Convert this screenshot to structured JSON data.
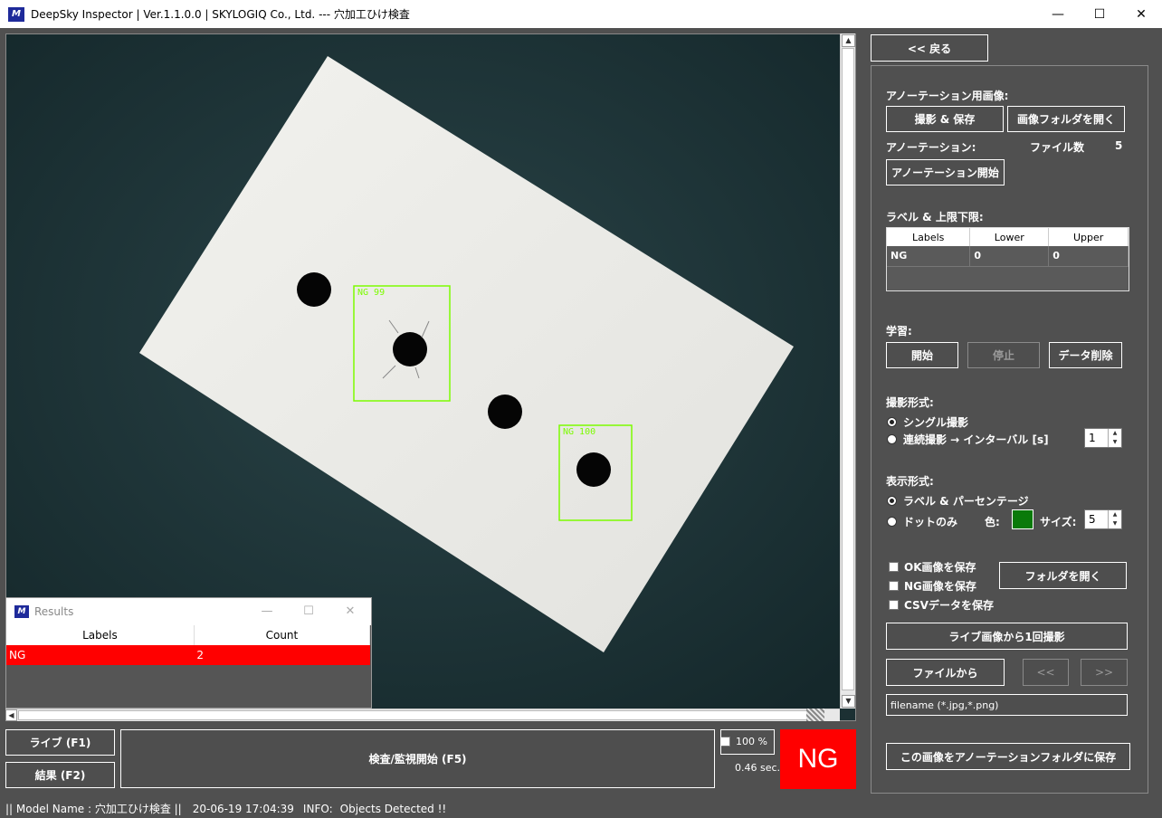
{
  "window": {
    "title": "DeepSky Inspector | Ver.1.1.0.0 | SKYLOGIQ Co., Ltd. --- 穴加工ひけ検査",
    "icon": "app-logo-icon"
  },
  "viewer": {
    "detections": [
      {
        "label": "NG 99"
      },
      {
        "label": "NG 100"
      }
    ]
  },
  "results_window": {
    "title": "Results",
    "columns": [
      "Labels",
      "Count"
    ],
    "rows": [
      {
        "label": "NG",
        "count": "2"
      }
    ]
  },
  "bottom": {
    "live_button": "ライブ (F1)",
    "result_button": "結果 (F2)",
    "inspect_button": "検査/監視開始 (F5)",
    "zoom_label": "100 %",
    "time_label": "0.46 sec.",
    "judgement": "NG",
    "judgement_color": "#ff0000"
  },
  "right": {
    "back_button": "<< 戻る",
    "annotation_image_label": "アノーテーション用画像:",
    "capture_save_button": "撮影 & 保存",
    "open_image_folder_button": "画像フォルダを開く",
    "annotation_label": "アノーテーション:",
    "file_count_label": "ファイル数",
    "file_count_value": "5",
    "annotation_start_button": "アノーテーション開始",
    "label_limits_label": "ラベル & 上限下限:",
    "limits_table": {
      "columns": [
        "Labels",
        "Lower",
        "Upper"
      ],
      "rows": [
        {
          "label": "NG",
          "lower": "0",
          "upper": "0"
        }
      ]
    },
    "learning_label": "学習:",
    "start_button": "開始",
    "stop_button": "停止",
    "delete_data_button": "データ削除",
    "capture_mode_label": "撮影形式:",
    "single_capture": "シングル撮影",
    "continuous_capture": "連続撮影 → インターバル [s]",
    "interval_value": "1",
    "display_mode_label": "表示形式:",
    "label_percentage": "ラベル & パーセンテージ",
    "dot_only": "ドットのみ",
    "color_label": "色:",
    "dot_color": "#0a7a0a",
    "size_label": "サイズ:",
    "size_value": "5",
    "save_ok": "OK画像を保存",
    "save_ng": "NG画像を保存",
    "save_csv": "CSVデータを保存",
    "open_folder_button": "フォルダを開く",
    "capture_once_button": "ライブ画像から1回撮影",
    "from_file_button": "ファイルから",
    "prev_button": "<<",
    "next_button": ">>",
    "filename_placeholder": "filename (*.jpg,*.png)",
    "save_to_annotation_button": "この画像をアノーテーションフォルダに保存"
  },
  "status_bar": {
    "model": "|| Model Name : 穴加工ひけ検査 ||",
    "timestamp": "20-06-19 17:04:39",
    "info_label": "INFO:",
    "info_text": "Objects Detected !!"
  }
}
